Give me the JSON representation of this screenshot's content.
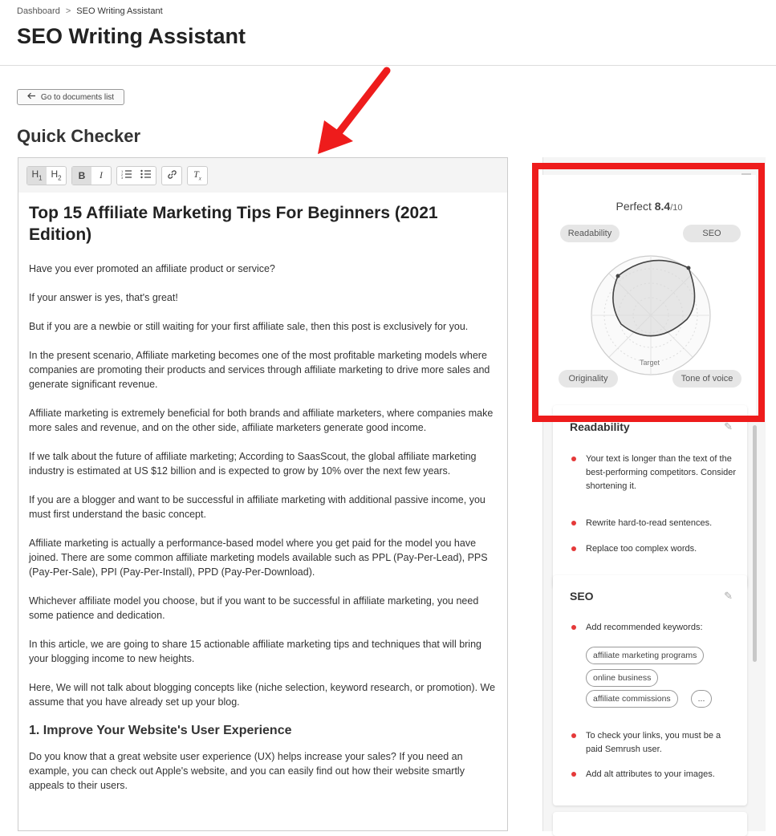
{
  "breadcrumb": {
    "home": "Dashboard",
    "separator": ">",
    "current": "SEO Writing Assistant"
  },
  "page_title": "SEO Writing Assistant",
  "back_button": {
    "label": "Go to documents list",
    "icon": "arrow-left-icon"
  },
  "section_title": "Quick Checker",
  "toolbar": {
    "h1": "H1",
    "h2": "H2",
    "bold": "B",
    "italic": "I",
    "ordered_list_icon": "ordered-list-icon",
    "bullet_list_icon": "bullet-list-icon",
    "link_icon": "link-icon",
    "clear_format_icon": "clear-format-icon"
  },
  "document": {
    "title": "Top 15 Affiliate Marketing Tips For Beginners (2021 Edition)",
    "paragraphs": [
      "Have you ever promoted an affiliate product or service?",
      "If your answer is yes, that's great!",
      "But if you are a newbie or still waiting for your first affiliate sale, then this post is exclusively for you.",
      "In the present scenario, Affiliate marketing becomes one of the most profitable marketing models where companies are promoting their products and services through affiliate marketing to drive more sales and generate significant revenue.",
      "Affiliate marketing is extremely beneficial for both brands and affiliate marketers, where companies make more sales and revenue, and on the other side, affiliate marketers generate good income.",
      "If we talk about the future of affiliate marketing; According to SaasScout, the global affiliate marketing industry is estimated at US $12 billion and is expected to grow by 10% over the next few years.",
      "If you are a blogger and want to be successful in affiliate marketing with additional passive income, you must first understand the basic concept.",
      "Affiliate marketing is actually a performance-based model where you get paid for the model you have joined. There are some common affiliate marketing models available such as PPL (Pay-Per-Lead), PPS (Pay-Per-Sale), PPI (Pay-Per-Install), PPD (Pay-Per-Download).",
      "Whichever affiliate model you choose, but if you want to be successful in affiliate marketing, you need some patience and dedication.",
      "In this article, we are going to share 15 actionable affiliate marketing tips and techniques that will bring your blogging income to new heights.",
      "Here, We will not talk about blogging concepts like (niche selection, keyword research, or promotion). We assume that you have already set up your blog."
    ],
    "subheading": "1. Improve Your Website's User Experience",
    "after_paragraph": "Do you know that a great website user experience (UX) helps increase your sales? If you need an example, you can check out Apple's website, and you can easily find out how their website smartly appeals to their users."
  },
  "score": {
    "label": "Perfect",
    "value": "8.4",
    "max": "/10",
    "axes": {
      "readability": "Readability",
      "seo": "SEO",
      "originality": "Originality",
      "tone": "Tone of voice"
    },
    "target_label": "Target"
  },
  "readability_card": {
    "title": "Readability",
    "items": [
      "Your text is longer than the text of the best-performing competitors. Consider shortening it.",
      "Rewrite hard-to-read sentences.",
      "Replace too complex words."
    ]
  },
  "seo_card": {
    "title": "SEO",
    "keywords_label": "Add recommended keywords:",
    "keywords": [
      "affiliate marketing programs",
      "online business",
      "affiliate commissions"
    ],
    "more": "...",
    "items": [
      "To check your links, you must be a paid Semrush user.",
      "Add alt attributes to your images."
    ]
  },
  "colors": {
    "highlight": "#ee1c1c",
    "annotation_arrow": "#ee1c1c",
    "dot": "#e53939"
  }
}
